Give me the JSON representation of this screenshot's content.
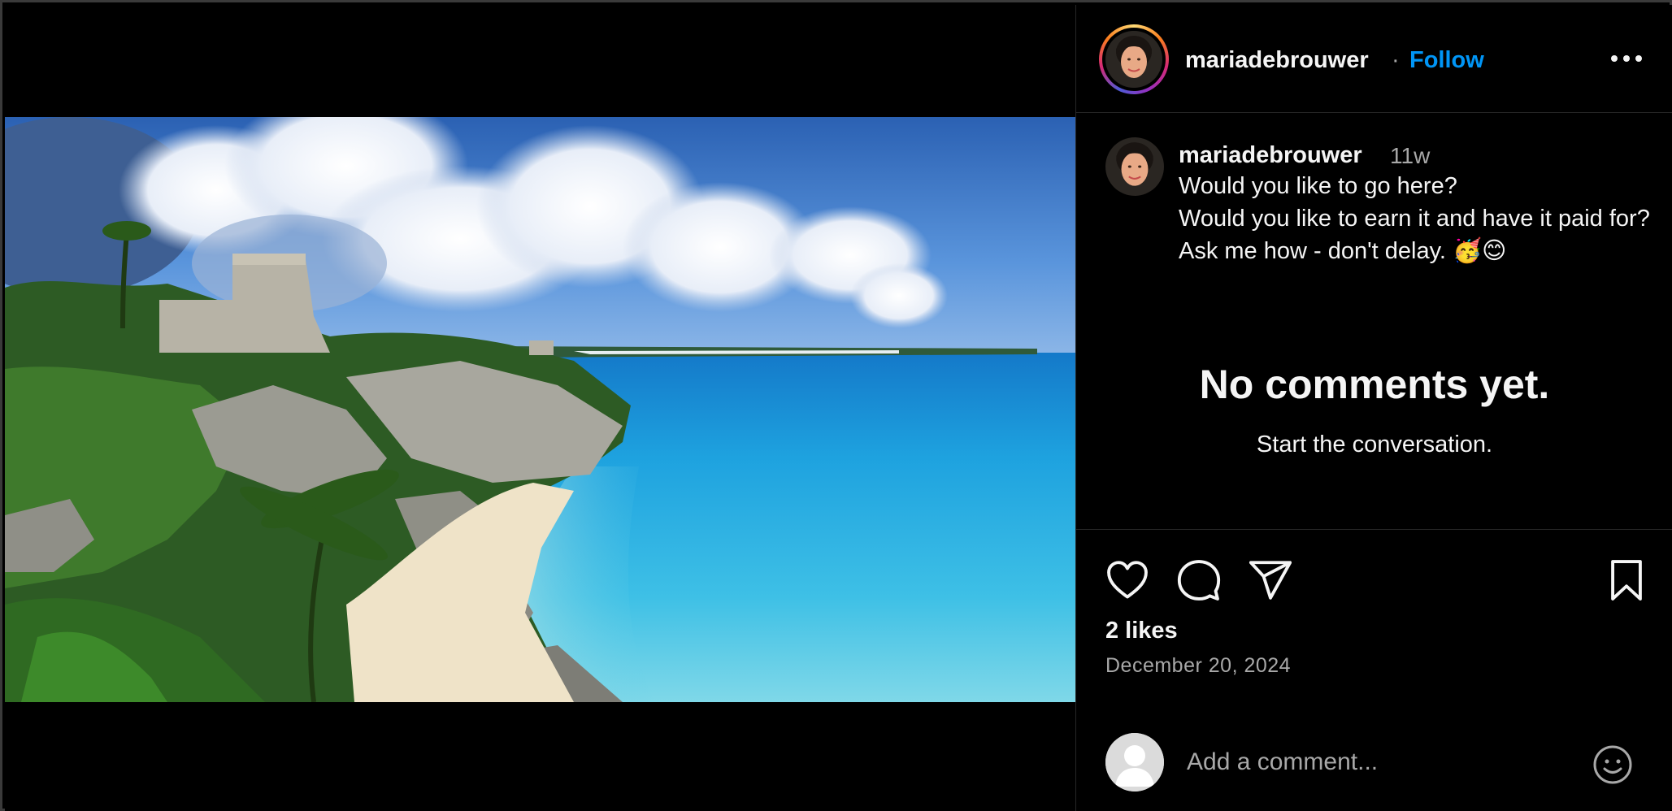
{
  "post": {
    "image_description": "Tulum ruins on a cliff above a turquoise Caribbean beach"
  },
  "header": {
    "username": "mariadebrouwer",
    "separator": "·",
    "follow_label": "Follow",
    "more_icon": "more-horizontal-icon"
  },
  "caption": {
    "username": "mariadebrouwer",
    "time_ago": "11w",
    "lines": [
      "Would you like to go here?",
      "Would you like to earn it and have it paid for?",
      "Ask me how - don't delay. 🥳😊"
    ]
  },
  "comments": {
    "empty_title": "No comments yet.",
    "empty_subtitle": "Start the conversation."
  },
  "actions": {
    "like_icon": "heart-icon",
    "comment_icon": "comment-icon",
    "share_icon": "share-icon",
    "save_icon": "bookmark-icon",
    "likes_text": "2 likes",
    "date_text": "December 20, 2024"
  },
  "add_comment": {
    "placeholder": "Add a comment...",
    "emoji_icon": "emoji-icon"
  },
  "colors": {
    "link_blue": "#0095f6",
    "muted": "#a8a8a8",
    "divider": "#262626"
  }
}
